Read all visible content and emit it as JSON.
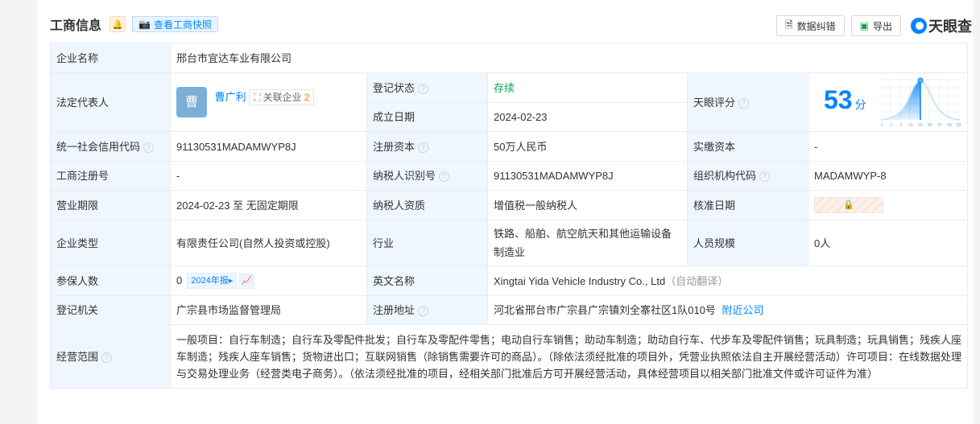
{
  "header": {
    "title": "工商信息",
    "snapshot": "查看工商快照",
    "correct": "数据纠错",
    "export": "导出",
    "brand": "天眼查"
  },
  "company_name": {
    "label": "企业名称",
    "value": "邢台市宜达车业有限公司"
  },
  "legal_rep": {
    "label": "法定代表人",
    "avatar": "曹",
    "name": "曹广利",
    "related_label": "关联企业",
    "related_count": "2"
  },
  "reg_status": {
    "label": "登记状态",
    "value": "存续"
  },
  "founded": {
    "label": "成立日期",
    "value": "2024-02-23"
  },
  "score": {
    "label": "天眼评分",
    "value": "53",
    "unit": "分",
    "ticks": [
      "0",
      "1",
      "3",
      "15",
      "50",
      "85",
      "97",
      "99",
      "100"
    ]
  },
  "credit_code": {
    "label": "统一社会信用代码",
    "value": "91130531MADAMWYP8J"
  },
  "reg_capital": {
    "label": "注册资本",
    "value": "50万人民币"
  },
  "paid_capital": {
    "label": "实缴资本",
    "value": "-"
  },
  "biz_reg_no": {
    "label": "工商注册号",
    "value": "-"
  },
  "taxpayer_id": {
    "label": "纳税人识别号",
    "value": "91130531MADAMWYP8J"
  },
  "org_code": {
    "label": "组织机构代码",
    "value": "MADAMWYP-8"
  },
  "term": {
    "label": "营业期限",
    "value": "2024-02-23 至 无固定期限"
  },
  "taxpayer_qual": {
    "label": "纳税人资质",
    "value": "增值税一般纳税人"
  },
  "approval_date": {
    "label": "核准日期"
  },
  "type": {
    "label": "企业类型",
    "value": "有限责任公司(自然人投资或控股)"
  },
  "industry": {
    "label": "行业",
    "value": "铁路、船舶、航空航天和其他运输设备制造业"
  },
  "staff": {
    "label": "人员规模",
    "value": "0人"
  },
  "insured": {
    "label": "参保人数",
    "value": "0",
    "report": "2024年报▸"
  },
  "english": {
    "label": "英文名称",
    "value": "Xingtai Yida Vehicle Industry Co., Ltd",
    "note": "（自动翻译）"
  },
  "authority": {
    "label": "登记机关",
    "value": "广宗县市场监督管理局"
  },
  "address": {
    "label": "注册地址",
    "value": "河北省邢台市广宗县广宗镇刘全寨社区1队010号",
    "nearby": "附近公司"
  },
  "scope": {
    "label": "经营范围",
    "value": "一般项目：自行车制造；自行车及零配件批发；自行车及零配件零售；电动自行车销售；助动车制造；助动自行车、代步车及零配件销售；玩具制造；玩具销售；残疾人座车制造；残疾人座车销售；货物进出口；互联网销售（除销售需要许可的商品）。（除依法须经批准的项目外，凭营业执照依法自主开展经营活动）许可项目：在线数据处理与交易处理业务（经营类电子商务）。（依法须经批准的项目，经相关部门批准后方可开展经营活动，具体经营项目以相关部门批准文件或许可证件为准）"
  }
}
